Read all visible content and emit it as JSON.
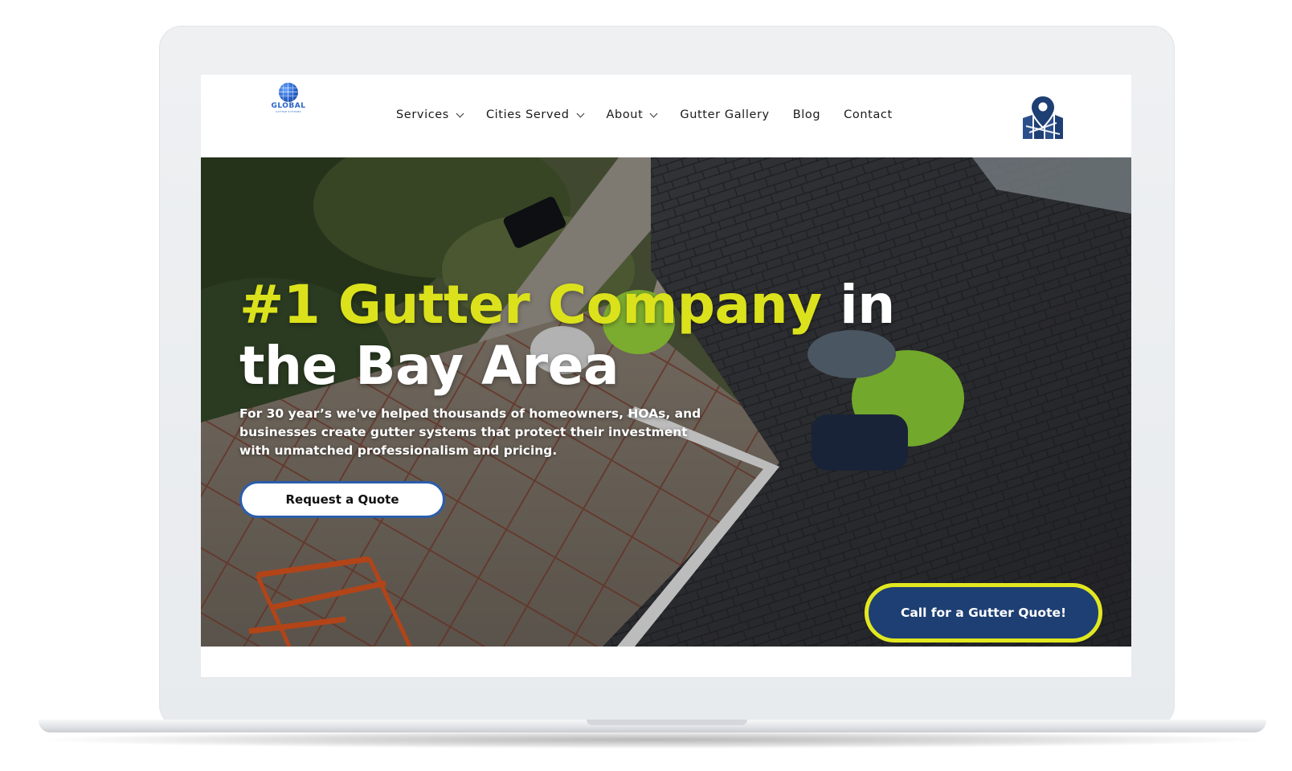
{
  "logo": {
    "name": "GLOBAL",
    "tagline": "GUTTER SYSTEMS"
  },
  "nav": {
    "items": [
      {
        "label": "Services",
        "has_dropdown": true
      },
      {
        "label": "Cities Served",
        "has_dropdown": true
      },
      {
        "label": "About",
        "has_dropdown": true
      },
      {
        "label": "Gutter Gallery",
        "has_dropdown": false
      },
      {
        "label": "Blog",
        "has_dropdown": false
      },
      {
        "label": "Contact",
        "has_dropdown": false
      }
    ],
    "map_icon": "map-pin-icon"
  },
  "hero": {
    "title_accent": "#1 Gutter Company",
    "title_rest": " in the Bay Area",
    "subtitle": "For 30 year’s we've helped thousands of homeowners, HOAs, and businesses create gutter systems that protect their investment with unmatched professionalism and pricing.",
    "primary_button": "Request a Quote",
    "call_button": "Call for a Gutter Quote!"
  },
  "colors": {
    "accent_yellow": "#dbe21c",
    "brand_blue": "#1e3f73",
    "button_border_blue": "#2b5dab"
  }
}
